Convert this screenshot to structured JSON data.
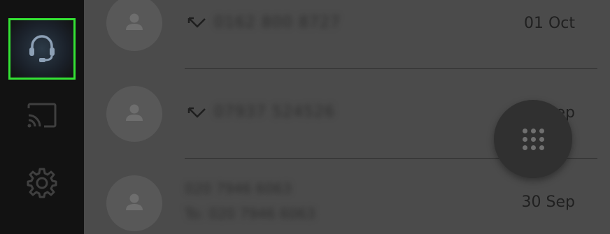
{
  "sidebar": {
    "items": [
      {
        "name": "support",
        "icon": "headset-icon",
        "selected": true
      },
      {
        "name": "cast",
        "icon": "cast-icon",
        "selected": false
      },
      {
        "name": "settings",
        "icon": "gear-icon",
        "selected": false
      }
    ],
    "highlight_color": "#34e234"
  },
  "calls": [
    {
      "icon": "call-received-icon",
      "number": "0162 800 8727",
      "date": "01 Oct"
    },
    {
      "icon": "call-received-icon",
      "number": "07937 524526",
      "date": "30 Sep"
    },
    {
      "icon": "",
      "number": "020 7946 6063",
      "subline": "To: 020 7946 6063",
      "date": "30 Sep"
    }
  ],
  "fab": {
    "icon": "dialpad-icon"
  }
}
